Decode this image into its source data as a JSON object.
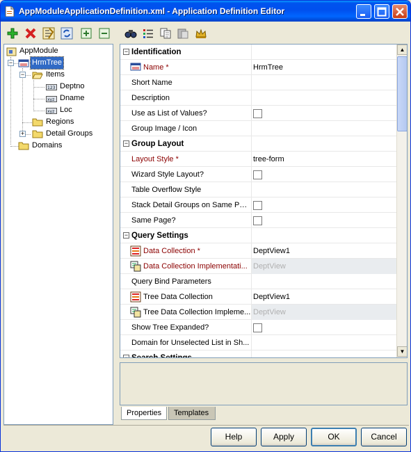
{
  "window": {
    "title": "AppModuleApplicationDefinition.xml - Application Definition Editor"
  },
  "toolbar_left": [
    "add-icon",
    "delete-icon",
    "properties-icon",
    "refresh-icon",
    "expand-all-icon",
    "collapse-all-icon"
  ],
  "toolbar_right": [
    "find-icon",
    "list-icon",
    "copy-icon",
    "paste-icon",
    "crown-icon"
  ],
  "tree": {
    "items": [
      {
        "label": "AppModule",
        "icon": "app-module-icon"
      },
      {
        "label": "HrmTree",
        "icon": "tree-table-icon",
        "selected": true
      },
      {
        "label": "Items",
        "icon": "folder-open-icon"
      },
      {
        "label": "Deptno",
        "icon": "attribute-number-icon"
      },
      {
        "label": "Dname",
        "icon": "attribute-string-icon"
      },
      {
        "label": "Loc",
        "icon": "attribute-string-icon"
      },
      {
        "label": "Regions",
        "icon": "folder-icon"
      },
      {
        "label": "Detail Groups",
        "icon": "folder-icon"
      },
      {
        "label": "Domains",
        "icon": "folder-icon"
      }
    ]
  },
  "properties": {
    "sections": [
      {
        "title": "Identification"
      },
      {
        "title": "Group Layout"
      },
      {
        "title": "Query Settings"
      }
    ],
    "rows": {
      "name": {
        "label": "Name *",
        "value": "HrmTree"
      },
      "short_name": {
        "label": "Short Name",
        "value": ""
      },
      "description": {
        "label": "Description",
        "value": ""
      },
      "use_as_lov": {
        "label": "Use as List of Values?",
        "checked": false
      },
      "group_image": {
        "label": "Group Image / Icon",
        "value": ""
      },
      "layout_style": {
        "label": "Layout Style *",
        "value": "tree-form"
      },
      "wizard_style": {
        "label": "Wizard Style Layout?",
        "checked": false
      },
      "table_overflow": {
        "label": "Table Overflow Style",
        "value": ""
      },
      "stack_detail": {
        "label": "Stack Detail Groups on Same Page?",
        "checked": false
      },
      "same_page": {
        "label": "Same Page?",
        "checked": false
      },
      "data_collection": {
        "label": "Data Collection *",
        "value": "DeptView1"
      },
      "data_collection_impl": {
        "label": "Data Collection Implementati...",
        "value": "DeptView"
      },
      "query_bind": {
        "label": "Query Bind Parameters",
        "value": ""
      },
      "tree_data_collection": {
        "label": "Tree Data Collection",
        "value": "DeptView1"
      },
      "tree_data_collection_impl": {
        "label": "Tree Data Collection Impleme...",
        "value": "DeptView"
      },
      "show_tree_expanded": {
        "label": "Show Tree Expanded?",
        "checked": false
      },
      "domain_unselected": {
        "label": "Domain for Unselected List in Sh...",
        "value": ""
      },
      "partial_section": {
        "label": "Search Settings"
      }
    }
  },
  "tabs": {
    "properties": "Properties",
    "templates": "Templates"
  },
  "buttons": {
    "help": "Help",
    "apply": "Apply",
    "ok": "OK",
    "cancel": "Cancel"
  }
}
